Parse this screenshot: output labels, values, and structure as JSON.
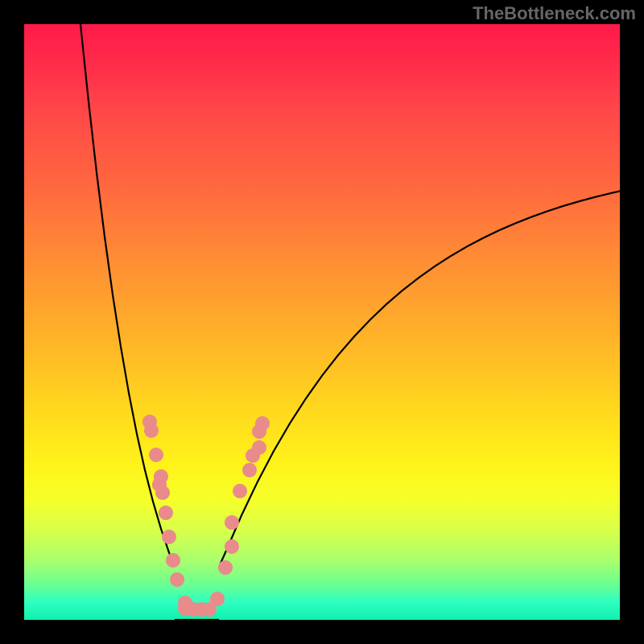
{
  "watermark": "TheBottleneck.com",
  "chart_data": {
    "type": "line",
    "title": "",
    "xlabel": "",
    "ylabel": "",
    "xlim": [
      0,
      100
    ],
    "ylim": [
      0,
      100
    ],
    "grid": false,
    "legend": false,
    "notes": "No axis labels or tick marks are shown. Background encodes vertical position via a red→yellow→green gradient. Two black curves descend from the top to a common minimum near x≈28,y≈0 and rise again; a band of salmon dots sits along both curves near the valley (roughly y 0–33).",
    "curve_left": {
      "x": [
        9.46,
        10.81,
        12.16,
        13.51,
        14.86,
        16.22,
        17.57,
        18.92,
        20.27,
        21.62,
        22.97,
        24.32,
        25.27
      ],
      "y": [
        100,
        87.03,
        75.14,
        64.35,
        54.6,
        45.86,
        38.08,
        31.2,
        25.16,
        19.88,
        15.29,
        11.3,
        8.89
      ]
    },
    "curve_right": {
      "x": [
        32.7,
        33.78,
        36.49,
        39.19,
        41.89,
        44.59,
        47.3,
        50.0,
        52.7,
        55.41,
        58.11,
        60.81,
        63.51,
        66.22,
        68.92,
        71.62,
        74.32,
        77.03,
        79.73,
        82.43,
        85.14,
        87.84,
        90.54,
        93.24,
        95.95,
        98.65,
        100.0
      ],
      "y": [
        8.89,
        11.3,
        17.54,
        23.2,
        28.33,
        32.97,
        37.17,
        40.98,
        44.44,
        47.57,
        50.41,
        52.98,
        55.31,
        57.42,
        59.34,
        61.08,
        62.66,
        64.09,
        65.39,
        66.56,
        67.63,
        68.6,
        69.48,
        70.28,
        71.01,
        71.66,
        71.97
      ]
    },
    "plateau": {
      "x": [
        25.27,
        32.7
      ],
      "y": [
        0,
        0
      ]
    },
    "dots": [
      {
        "x": 21.08,
        "y": 33.24
      },
      {
        "x": 21.35,
        "y": 31.76
      },
      {
        "x": 22.16,
        "y": 27.7
      },
      {
        "x": 22.97,
        "y": 24.05
      },
      {
        "x": 22.7,
        "y": 22.7
      },
      {
        "x": 23.24,
        "y": 21.35
      },
      {
        "x": 23.78,
        "y": 17.97
      },
      {
        "x": 24.32,
        "y": 13.92
      },
      {
        "x": 25.0,
        "y": 10.0
      },
      {
        "x": 25.68,
        "y": 6.76
      },
      {
        "x": 27.03,
        "y": 2.84
      },
      {
        "x": 27.03,
        "y": 1.89
      },
      {
        "x": 28.38,
        "y": 1.76
      },
      {
        "x": 29.73,
        "y": 1.76
      },
      {
        "x": 31.08,
        "y": 1.76
      },
      {
        "x": 32.43,
        "y": 3.51
      },
      {
        "x": 33.78,
        "y": 8.78
      },
      {
        "x": 34.86,
        "y": 12.3
      },
      {
        "x": 34.86,
        "y": 16.35
      },
      {
        "x": 36.22,
        "y": 21.62
      },
      {
        "x": 37.84,
        "y": 25.14
      },
      {
        "x": 38.38,
        "y": 27.57
      },
      {
        "x": 39.46,
        "y": 28.92
      },
      {
        "x": 39.46,
        "y": 31.62
      },
      {
        "x": 40.0,
        "y": 32.97
      }
    ],
    "dot_color": "#e98b8b",
    "dot_radius_px": 9
  }
}
